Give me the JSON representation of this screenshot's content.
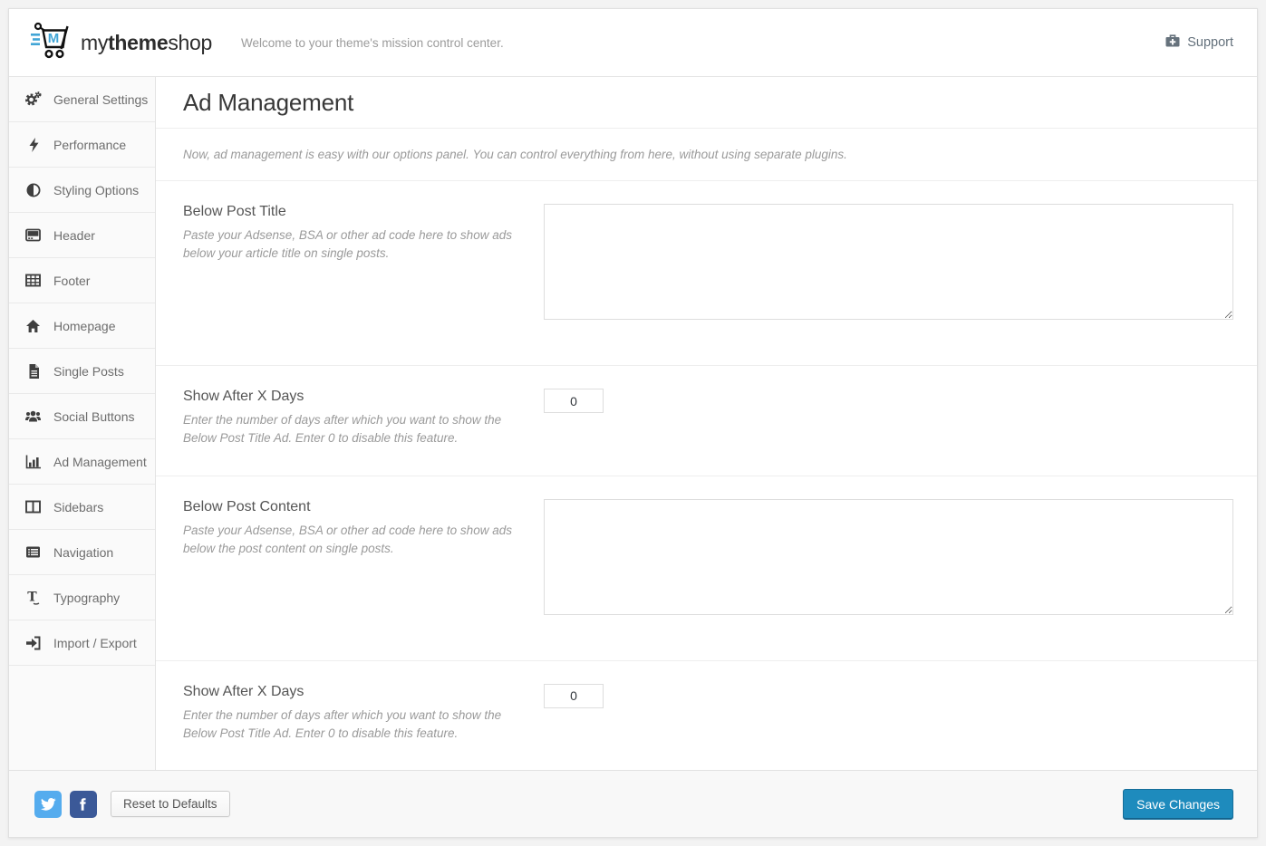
{
  "header": {
    "brand": {
      "my": "my",
      "theme": "theme",
      "shop": "shop"
    },
    "tagline": "Welcome to your theme's mission control center.",
    "support_label": "Support"
  },
  "sidebar": {
    "items": [
      {
        "label": "General Settings",
        "icon": "gears-icon",
        "active": false
      },
      {
        "label": "Performance",
        "icon": "bolt-icon",
        "active": false
      },
      {
        "label": "Styling Options",
        "icon": "adjust-icon",
        "active": false
      },
      {
        "label": "Header",
        "icon": "header-icon",
        "active": false
      },
      {
        "label": "Footer",
        "icon": "table-icon",
        "active": false
      },
      {
        "label": "Homepage",
        "icon": "home-icon",
        "active": false
      },
      {
        "label": "Single Posts",
        "icon": "file-icon",
        "active": false
      },
      {
        "label": "Social Buttons",
        "icon": "users-icon",
        "active": false
      },
      {
        "label": "Ad Management",
        "icon": "bar-chart-icon",
        "active": true
      },
      {
        "label": "Sidebars",
        "icon": "columns-icon",
        "active": false
      },
      {
        "label": "Navigation",
        "icon": "list-icon",
        "active": false
      },
      {
        "label": "Typography",
        "icon": "typography-icon",
        "active": false
      },
      {
        "label": "Import / Export",
        "icon": "sign-in-icon",
        "active": false
      }
    ]
  },
  "main": {
    "title": "Ad Management",
    "description": "Now, ad management is easy with our options panel. You can control everything from here, without using separate plugins.",
    "sections": [
      {
        "label": "Below Post Title",
        "description": "Paste your Adsense, BSA or other ad code here to show ads below your article title on single posts.",
        "control": "textarea",
        "value": ""
      },
      {
        "label": "Show After X Days",
        "description": "Enter the number of days after which you want to show the Below Post Title Ad. Enter 0 to disable this feature.",
        "control": "number",
        "value": "0"
      },
      {
        "label": "Below Post Content",
        "description": "Paste your Adsense, BSA or other ad code here to show ads below the post content on single posts.",
        "control": "textarea",
        "value": ""
      },
      {
        "label": "Show After X Days",
        "description": "Enter the number of days after which you want to show the Below Post Title Ad. Enter 0 to disable this feature.",
        "control": "number",
        "value": "0"
      }
    ]
  },
  "footer": {
    "reset_label": "Reset to Defaults",
    "save_label": "Save Changes",
    "social": [
      "twitter",
      "facebook"
    ]
  },
  "colors": {
    "save_button": "#1e8bbd",
    "twitter": "#55acee",
    "facebook": "#3b5998",
    "logo_accent": "#41a5d6",
    "icon": "#3f3f3f"
  }
}
